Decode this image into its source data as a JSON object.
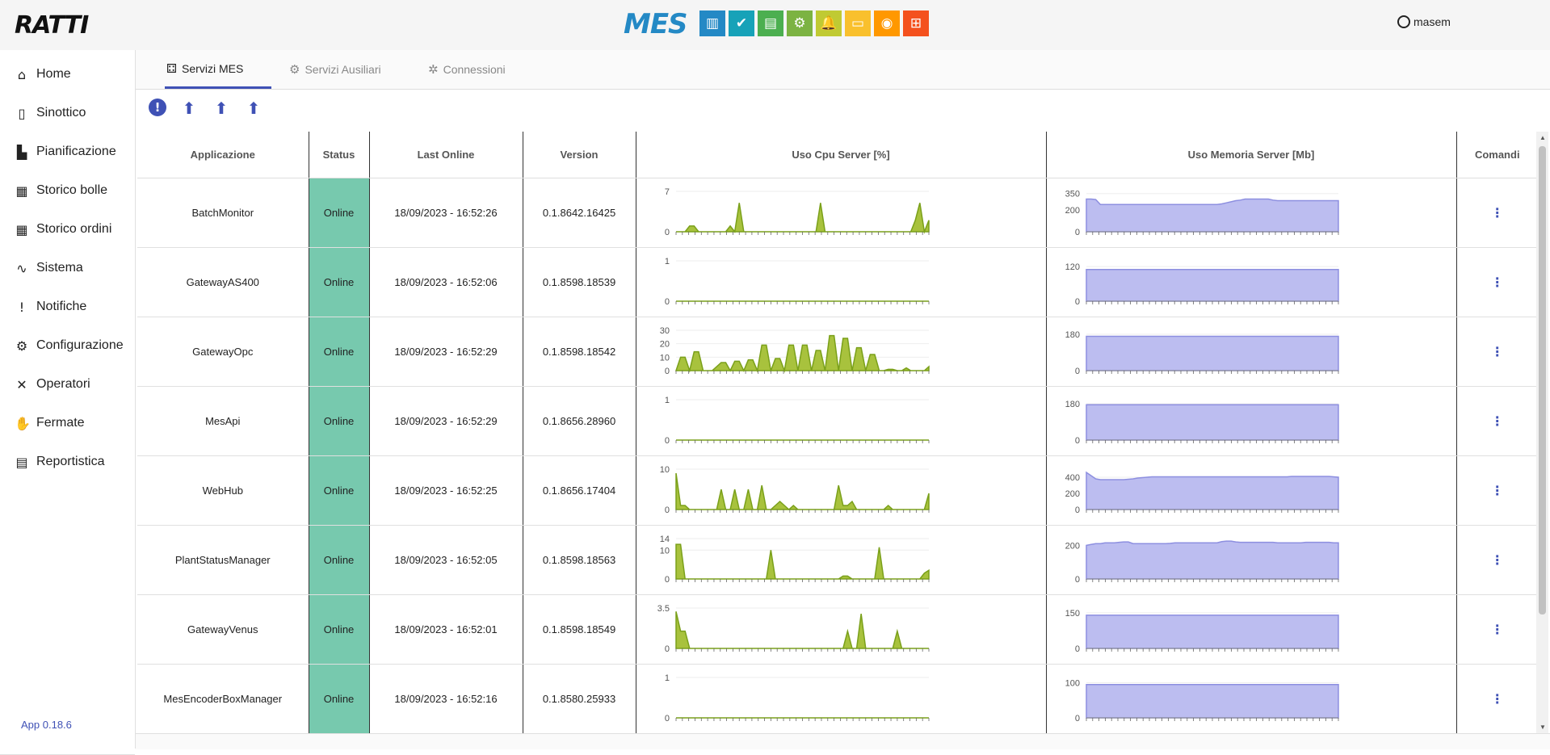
{
  "header": {
    "logo": "RATTI",
    "mes_label": "MES",
    "mes_icons": [
      {
        "name": "chart-bars-icon",
        "glyph": "▥",
        "color": "#2489c5"
      },
      {
        "name": "check-circle-icon",
        "glyph": "✔",
        "color": "#17a2b8"
      },
      {
        "name": "document-icon",
        "glyph": "▤",
        "color": "#4caf50"
      },
      {
        "name": "gears-icon",
        "glyph": "⚙",
        "color": "#7cb342"
      },
      {
        "name": "bell-icon",
        "glyph": "🔔",
        "color": "#c0ca33"
      },
      {
        "name": "screen-icon",
        "glyph": "▭",
        "color": "#f9c02d"
      },
      {
        "name": "eye-icon",
        "glyph": "◉",
        "color": "#ff9800"
      },
      {
        "name": "sitemap-icon",
        "glyph": "⊞",
        "color": "#f4511e"
      }
    ],
    "user": "masem"
  },
  "sidebar": {
    "items": [
      {
        "label": "Home",
        "icon": "⌂",
        "name": "home"
      },
      {
        "label": "Sinottico",
        "icon": "▯",
        "name": "sinottico"
      },
      {
        "label": "Pianificazione",
        "icon": "▙",
        "name": "pianificazione"
      },
      {
        "label": "Storico bolle",
        "icon": "▦",
        "name": "storico-bolle"
      },
      {
        "label": "Storico ordini",
        "icon": "▦",
        "name": "storico-ordini"
      },
      {
        "label": "Sistema",
        "icon": "∿",
        "name": "sistema"
      },
      {
        "label": "Notifiche",
        "icon": "!",
        "name": "notifiche"
      },
      {
        "label": "Configurazione",
        "icon": "⚙",
        "name": "configurazione"
      },
      {
        "label": "Operatori",
        "icon": "✕",
        "name": "operatori"
      },
      {
        "label": "Fermate",
        "icon": "✋",
        "name": "fermate"
      },
      {
        "label": "Reportistica",
        "icon": "▤",
        "name": "reportistica"
      }
    ],
    "version": "App 0.18.6"
  },
  "tabs": [
    {
      "label": "Servizi MES",
      "icon": "⚃",
      "active": true
    },
    {
      "label": "Servizi Ausiliari",
      "icon": "⚙",
      "active": false
    },
    {
      "label": "Connessioni",
      "icon": "✲",
      "active": false
    }
  ],
  "columns": [
    "Applicazione",
    "Status",
    "Last Online",
    "Version",
    "Uso Cpu Server [%]",
    "Uso Memoria Server [Mb]",
    "Comandi"
  ],
  "rows": [
    {
      "app": "BatchMonitor",
      "status": "Online",
      "last": "18/09/2023 - 16:52:26",
      "version": "0.1.8642.16425",
      "cpu": {
        "ticks": [
          "7",
          "0"
        ],
        "max": 7,
        "values": [
          0,
          0,
          0,
          1,
          1,
          0,
          0,
          0,
          0,
          0,
          0,
          0,
          1,
          0,
          5,
          0,
          0,
          0,
          0,
          0,
          0,
          0,
          0,
          0,
          0,
          0,
          0,
          0,
          0,
          0,
          0,
          0,
          5,
          0,
          0,
          0,
          0,
          0,
          0,
          0,
          0,
          0,
          0,
          0,
          0,
          0,
          0,
          0,
          0,
          0,
          0,
          0,
          0,
          2,
          5,
          0,
          2
        ]
      },
      "mem": {
        "ticks": [
          "350",
          "200",
          "0"
        ],
        "max": 370,
        "values": [
          300,
          300,
          295,
          250,
          250,
          250,
          250,
          250,
          250,
          250,
          250,
          250,
          250,
          250,
          250,
          250,
          250,
          250,
          250,
          250,
          250,
          250,
          250,
          250,
          250,
          250,
          250,
          250,
          250,
          255,
          265,
          275,
          285,
          290,
          300,
          300,
          300,
          300,
          300,
          300,
          290,
          285,
          285,
          285,
          285,
          285,
          285,
          285,
          285,
          285,
          285,
          285,
          285,
          285,
          285
        ]
      }
    },
    {
      "app": "GatewayAS400",
      "status": "Online",
      "last": "18/09/2023 - 16:52:06",
      "version": "0.1.8598.18539",
      "cpu": {
        "ticks": [
          "1",
          "0"
        ],
        "max": 1,
        "values": [
          0,
          0,
          0,
          0,
          0,
          0,
          0,
          0,
          0,
          0,
          0,
          0,
          0,
          0,
          0,
          0,
          0,
          0,
          0,
          0,
          0,
          0,
          0,
          0,
          0,
          0,
          0,
          0,
          0,
          0,
          0,
          0,
          0,
          0,
          0,
          0,
          0,
          0,
          0,
          0,
          0,
          0,
          0,
          0,
          0,
          0,
          0,
          0,
          0,
          0,
          0,
          0,
          0,
          0,
          0,
          0,
          0
        ]
      },
      "mem": {
        "ticks": [
          "120",
          "0"
        ],
        "max": 140,
        "values": [
          110,
          110,
          110,
          110,
          110,
          110,
          110,
          110,
          110,
          110,
          110,
          110,
          110,
          110,
          110,
          110,
          110,
          110,
          110,
          110,
          110,
          110,
          110,
          110,
          110,
          110,
          110,
          110,
          110,
          110,
          110,
          110,
          110,
          110,
          110,
          110,
          110,
          110,
          110,
          110,
          110,
          110,
          110,
          110,
          110,
          110,
          110,
          110,
          110,
          110,
          110,
          110,
          110,
          110,
          110
        ]
      }
    },
    {
      "app": "GatewayOpc",
      "status": "Online",
      "last": "18/09/2023 - 16:52:29",
      "version": "0.1.8598.18542",
      "cpu": {
        "ticks": [
          "30",
          "20",
          "10",
          "0"
        ],
        "max": 30,
        "values": [
          0,
          10,
          10,
          0,
          14,
          14,
          0,
          0,
          0,
          3,
          6,
          6,
          0,
          7,
          7,
          0,
          8,
          8,
          0,
          19,
          19,
          0,
          9,
          9,
          0,
          19,
          19,
          0,
          19,
          19,
          0,
          15,
          15,
          0,
          26,
          26,
          0,
          24,
          24,
          0,
          17,
          17,
          0,
          12,
          12,
          0,
          0,
          1,
          1,
          0,
          0,
          2,
          0,
          0,
          0,
          0,
          3
        ]
      },
      "mem": {
        "ticks": [
          "180",
          "0"
        ],
        "max": 200,
        "values": [
          170,
          170,
          170,
          170,
          170,
          170,
          170,
          170,
          170,
          170,
          170,
          170,
          170,
          170,
          170,
          170,
          170,
          170,
          170,
          170,
          170,
          170,
          170,
          170,
          170,
          170,
          170,
          170,
          170,
          170,
          170,
          170,
          170,
          170,
          170,
          170,
          170,
          170,
          170,
          170,
          170,
          170,
          170,
          170,
          170,
          170,
          170,
          170,
          170,
          170,
          170,
          170,
          170,
          170,
          170
        ]
      }
    },
    {
      "app": "MesApi",
      "status": "Online",
      "last": "18/09/2023 - 16:52:29",
      "version": "0.1.8656.28960",
      "cpu": {
        "ticks": [
          "1",
          "0"
        ],
        "max": 1,
        "values": [
          0,
          0,
          0,
          0,
          0,
          0,
          0,
          0,
          0,
          0,
          0,
          0,
          0,
          0,
          0,
          0,
          0,
          0,
          0,
          0,
          0,
          0,
          0,
          0,
          0,
          0,
          0,
          0,
          0,
          0,
          0,
          0,
          0,
          0,
          0,
          0,
          0,
          0,
          0,
          0,
          0,
          0,
          0,
          0,
          0,
          0,
          0,
          0,
          0,
          0,
          0,
          0,
          0,
          0,
          0,
          0,
          0
        ]
      },
      "mem": {
        "ticks": [
          "180",
          "0"
        ],
        "max": 200,
        "values": [
          175,
          175,
          175,
          175,
          175,
          175,
          175,
          175,
          175,
          175,
          175,
          175,
          175,
          175,
          175,
          175,
          175,
          175,
          175,
          175,
          175,
          175,
          175,
          175,
          175,
          175,
          175,
          175,
          175,
          175,
          175,
          175,
          175,
          175,
          175,
          175,
          175,
          175,
          175,
          175,
          175,
          175,
          175,
          175,
          175,
          175,
          175,
          175,
          175,
          175,
          175,
          175,
          175,
          175,
          175
        ]
      }
    },
    {
      "app": "WebHub",
      "status": "Online",
      "last": "18/09/2023 - 16:52:25",
      "version": "0.1.8656.17404",
      "cpu": {
        "ticks": [
          "10",
          "0"
        ],
        "max": 10,
        "values": [
          9,
          1,
          1,
          0,
          0,
          0,
          0,
          0,
          0,
          0,
          5,
          0,
          0,
          5,
          0,
          0,
          5,
          0,
          0,
          6,
          0,
          0,
          1,
          2,
          1,
          0,
          1,
          0,
          0,
          0,
          0,
          0,
          0,
          0,
          0,
          0,
          6,
          1,
          1,
          2,
          0,
          0,
          0,
          0,
          0,
          0,
          0,
          1,
          0,
          0,
          0,
          0,
          0,
          0,
          0,
          0,
          4
        ]
      },
      "mem": {
        "ticks": [
          "400",
          "200",
          "0"
        ],
        "max": 500,
        "values": [
          460,
          420,
          380,
          370,
          370,
          370,
          370,
          370,
          370,
          375,
          380,
          390,
          395,
          400,
          405,
          405,
          405,
          405,
          405,
          405,
          405,
          405,
          405,
          405,
          405,
          405,
          405,
          405,
          405,
          405,
          405,
          405,
          405,
          405,
          405,
          405,
          405,
          405,
          405,
          405,
          405,
          405,
          405,
          405,
          410,
          410,
          410,
          410,
          410,
          410,
          410,
          410,
          410,
          405,
          400
        ]
      }
    },
    {
      "app": "PlantStatusManager",
      "status": "Online",
      "last": "18/09/2023 - 16:52:05",
      "version": "0.1.8598.18563",
      "cpu": {
        "ticks": [
          "14",
          "10",
          "0"
        ],
        "max": 14,
        "values": [
          12,
          12,
          0,
          0,
          0,
          0,
          0,
          0,
          0,
          0,
          0,
          0,
          0,
          0,
          0,
          0,
          0,
          0,
          0,
          0,
          0,
          10,
          0,
          0,
          0,
          0,
          0,
          0,
          0,
          0,
          0,
          0,
          0,
          0,
          0,
          0,
          0,
          1,
          1,
          0,
          0,
          0,
          0,
          0,
          0,
          11,
          0,
          0,
          0,
          0,
          0,
          0,
          0,
          0,
          0,
          2,
          3
        ]
      },
      "mem": {
        "ticks": [
          "200",
          "0"
        ],
        "max": 240,
        "values": [
          200,
          205,
          210,
          210,
          215,
          215,
          215,
          218,
          220,
          220,
          210,
          210,
          210,
          210,
          210,
          210,
          210,
          210,
          212,
          215,
          215,
          215,
          215,
          215,
          215,
          215,
          215,
          215,
          215,
          222,
          225,
          225,
          220,
          218,
          218,
          218,
          218,
          218,
          218,
          218,
          218,
          215,
          215,
          215,
          215,
          215,
          215,
          218,
          218,
          218,
          218,
          218,
          218,
          215,
          215
        ]
      }
    },
    {
      "app": "GatewayVenus",
      "status": "Online",
      "last": "18/09/2023 - 16:52:01",
      "version": "0.1.8598.18549",
      "cpu": {
        "ticks": [
          "3.5",
          "0"
        ],
        "max": 3.5,
        "values": [
          3.2,
          1.5,
          1.5,
          0,
          0,
          0,
          0,
          0,
          0,
          0,
          0,
          0,
          0,
          0,
          0,
          0,
          0,
          0,
          0,
          0,
          0,
          0,
          0,
          0,
          0,
          0,
          0,
          0,
          0,
          0,
          0,
          0,
          0,
          0,
          0,
          0,
          0,
          0,
          1.5,
          0,
          0,
          3,
          0,
          0,
          0,
          0,
          0,
          0,
          0,
          1.5,
          0,
          0,
          0,
          0,
          0,
          0,
          0
        ]
      },
      "mem": {
        "ticks": [
          "150",
          "0"
        ],
        "max": 170,
        "values": [
          140,
          140,
          140,
          140,
          140,
          140,
          140,
          140,
          140,
          140,
          140,
          140,
          140,
          140,
          140,
          140,
          140,
          140,
          140,
          140,
          140,
          140,
          140,
          140,
          140,
          140,
          140,
          140,
          140,
          140,
          140,
          140,
          140,
          140,
          140,
          140,
          140,
          140,
          140,
          140,
          140,
          140,
          140,
          140,
          140,
          140,
          140,
          140,
          140,
          140,
          140,
          140,
          140,
          140,
          140
        ]
      }
    },
    {
      "app": "MesEncoderBoxManager",
      "status": "Online",
      "last": "18/09/2023 - 16:52:16",
      "version": "0.1.8580.25933",
      "cpu": {
        "ticks": [
          "1",
          "0"
        ],
        "max": 1,
        "values": [
          0,
          0,
          0,
          0,
          0,
          0,
          0,
          0,
          0,
          0,
          0,
          0,
          0,
          0,
          0,
          0,
          0,
          0,
          0,
          0,
          0,
          0,
          0,
          0,
          0,
          0,
          0,
          0,
          0,
          0,
          0,
          0,
          0,
          0,
          0,
          0,
          0,
          0,
          0,
          0,
          0,
          0,
          0,
          0,
          0,
          0,
          0,
          0,
          0,
          0,
          0,
          0,
          0,
          0,
          0,
          0,
          0
        ]
      },
      "mem": {
        "ticks": [
          "100",
          "0"
        ],
        "max": 115,
        "values": [
          95,
          95,
          95,
          95,
          95,
          95,
          95,
          95,
          95,
          95,
          95,
          95,
          95,
          95,
          95,
          95,
          95,
          95,
          95,
          95,
          95,
          95,
          95,
          95,
          95,
          95,
          95,
          95,
          95,
          95,
          95,
          95,
          95,
          95,
          95,
          95,
          95,
          95,
          95,
          95,
          95,
          95,
          95,
          95,
          95,
          95,
          95,
          95,
          95,
          95,
          95,
          95,
          95,
          95,
          95
        ]
      }
    }
  ],
  "command_glyph": "⋮",
  "colors": {
    "cpu_fill": "#a8c23d",
    "cpu_line": "#7aa01a",
    "mem_fill": "#bcbdf0",
    "mem_line": "#8d8fe0",
    "status_bg": "#77c9ae",
    "accent": "#3f51b5"
  }
}
